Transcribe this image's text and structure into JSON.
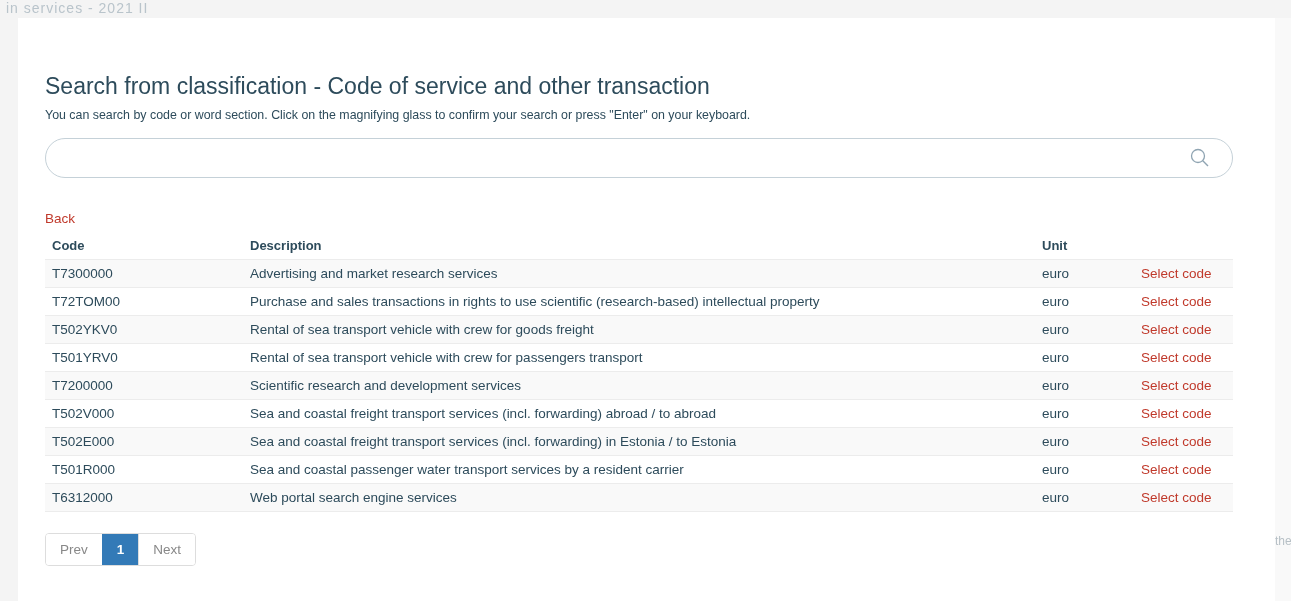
{
  "background": {
    "heading": "in services - 2021 II",
    "side_text": "the"
  },
  "dialog": {
    "title": "Search from classification - Code of service and other transaction",
    "hint": "You can search by code or word section. Click on the magnifying glass to confirm your search or press \"Enter\" on your keyboard.",
    "back": "Back",
    "table": {
      "columns": [
        "Code",
        "Description",
        "Unit"
      ],
      "rows": [
        {
          "code": "T7300000",
          "description": "Advertising and market research services",
          "unit": "euro",
          "action": "Select code"
        },
        {
          "code": "T72TOM00",
          "description": "Purchase and sales transactions in rights to use scientific (research-based) intellectual property",
          "unit": "euro",
          "action": "Select code"
        },
        {
          "code": "T502YKV0",
          "description": "Rental of sea transport vehicle with crew for goods freight",
          "unit": "euro",
          "action": "Select code"
        },
        {
          "code": "T501YRV0",
          "description": "Rental of sea transport vehicle with crew for passengers transport",
          "unit": "euro",
          "action": "Select code"
        },
        {
          "code": "T7200000",
          "description": "Scientific research and development services",
          "unit": "euro",
          "action": "Select code"
        },
        {
          "code": "T502V000",
          "description": "Sea and coastal freight transport services (incl. forwarding) abroad / to abroad",
          "unit": "euro",
          "action": "Select code"
        },
        {
          "code": "T502E000",
          "description": "Sea and coastal freight transport services (incl. forwarding) in Estonia / to Estonia",
          "unit": "euro",
          "action": "Select code"
        },
        {
          "code": "T501R000",
          "description": "Sea and coastal passenger water transport services by a resident carrier",
          "unit": "euro",
          "action": "Select code"
        },
        {
          "code": "T6312000",
          "description": "Web portal search engine services",
          "unit": "euro",
          "action": "Select code"
        }
      ]
    },
    "pagination": [
      {
        "label": "Prev",
        "selected": false
      },
      {
        "label": "1",
        "selected": true
      },
      {
        "label": "Next",
        "selected": false
      }
    ]
  }
}
